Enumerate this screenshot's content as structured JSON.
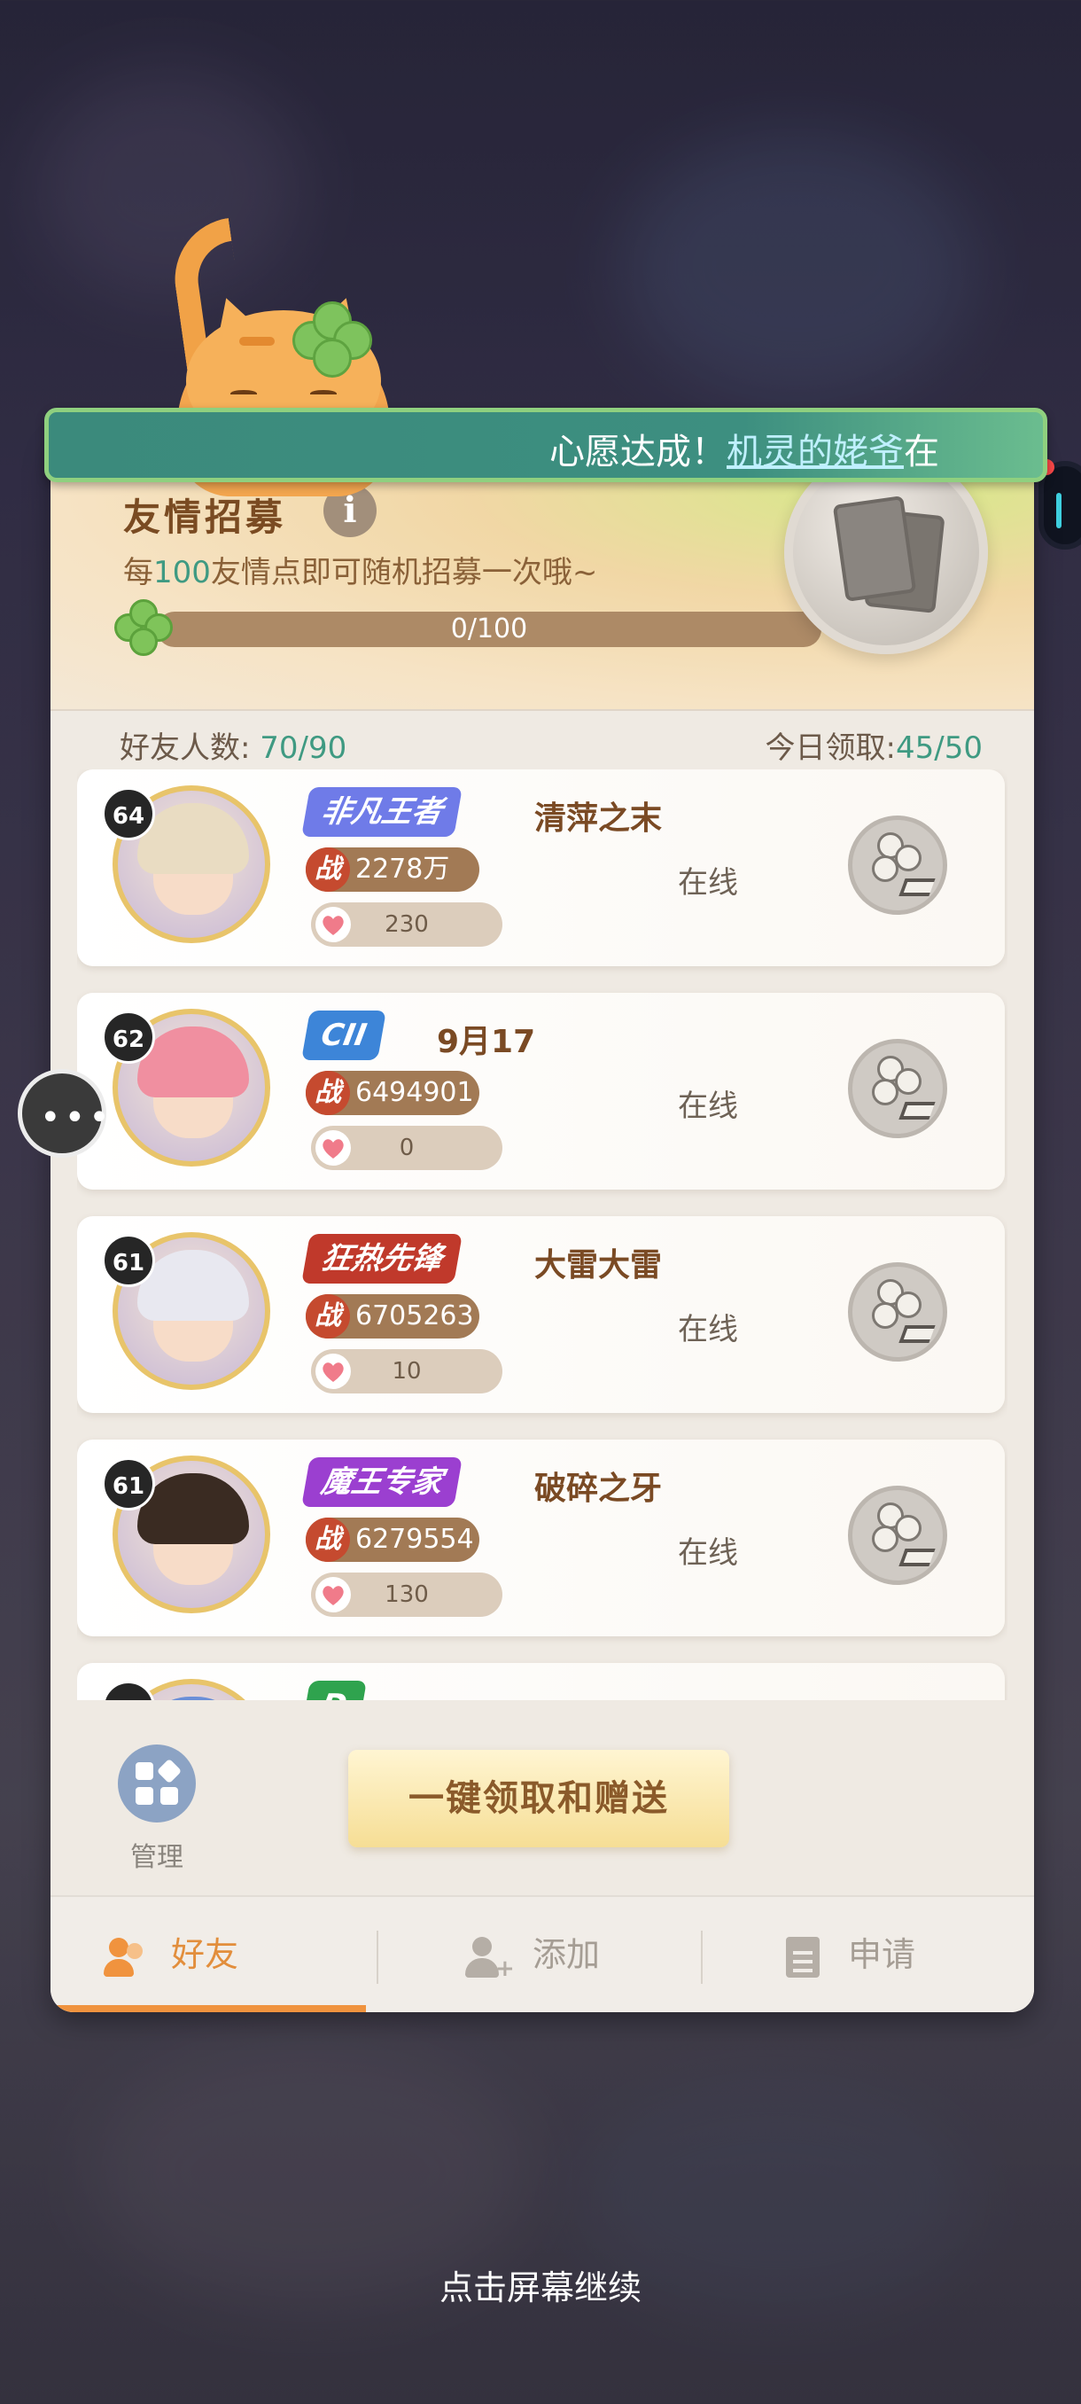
{
  "banner": {
    "prefix": "心愿达成！",
    "name": "机灵的姥爷",
    "suffix": "在"
  },
  "recruit": {
    "title": "友情招募",
    "subtitle_pre": "每",
    "subtitle_num": "100",
    "subtitle_post": "友情点即可随机招募一次哦~",
    "progress_text": "0/100",
    "progress_fraction": 0
  },
  "counts": {
    "friends_label": "好友人数:",
    "friends_value": "70/90",
    "today_label": "今日领取:",
    "today_value": "45/50"
  },
  "friends": [
    {
      "level": "64",
      "badge": "非凡王者",
      "badge_color": "#6f7be8",
      "name": "清萍之末",
      "power_tag": "战",
      "power": "2278万",
      "hearts": "230",
      "status": "在线"
    },
    {
      "level": "62",
      "badge": "CII",
      "badge_color": "#3d85d8",
      "name": "9月17",
      "power_tag": "战",
      "power": "6494901",
      "hearts": "0",
      "status": "在线"
    },
    {
      "level": "61",
      "badge": "狂热先锋",
      "badge_color": "#c0392b",
      "name": "大雷大雷",
      "power_tag": "战",
      "power": "6705263",
      "hearts": "10",
      "status": "在线"
    },
    {
      "level": "61",
      "badge": "魔王专家",
      "badge_color": "#9b3fd0",
      "name": "破碎之牙",
      "power_tag": "战",
      "power": "6279554",
      "hearts": "130",
      "status": "在线"
    },
    {
      "level": "",
      "badge": "D",
      "badge_color": "#2fa34e",
      "name": "",
      "power_tag": "",
      "power": "",
      "hearts": "",
      "status": ""
    }
  ],
  "actions": {
    "manage_label": "管理",
    "one_key_label": "一键领取和赠送"
  },
  "tabs": [
    {
      "label": "好友",
      "icon": "friends-icon"
    },
    {
      "label": "添加",
      "icon": "add-user-icon"
    },
    {
      "label": "申请",
      "icon": "document-icon"
    }
  ],
  "continue_text": "点击屏幕继续",
  "colors": {
    "accent": "#e28e3c",
    "teal": "#3f9a82",
    "brown": "#7a4a24"
  }
}
